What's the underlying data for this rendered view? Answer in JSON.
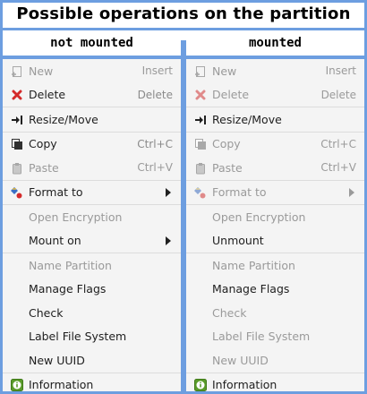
{
  "title": "Possible operations on the partition",
  "columns": {
    "left": {
      "heading": "not mounted"
    },
    "right": {
      "heading": "mounted"
    }
  },
  "colors": {
    "accent": "#6d9ee0",
    "disabled_text": "#9a9a9a",
    "delete_red": "#d42a2a",
    "info_green": "#5a9b2a"
  },
  "left_menu": {
    "new": {
      "label": "New",
      "shortcut": "Insert",
      "enabled": false,
      "icon": "new-document-icon"
    },
    "delete": {
      "label": "Delete",
      "shortcut": "Delete",
      "enabled": true,
      "icon": "delete-x-icon"
    },
    "resize": {
      "label": "Resize/Move",
      "enabled": true,
      "icon": "resize-arrow-icon"
    },
    "copy": {
      "label": "Copy",
      "shortcut": "Ctrl+C",
      "enabled": true,
      "icon": "copy-icon"
    },
    "paste": {
      "label": "Paste",
      "shortcut": "Ctrl+V",
      "enabled": false,
      "icon": "paste-icon"
    },
    "format": {
      "label": "Format to",
      "enabled": true,
      "icon": "format-icon",
      "has_submenu": true
    },
    "open_encryption": {
      "label": "Open Encryption",
      "enabled": false
    },
    "mount": {
      "label": "Mount on",
      "enabled": true,
      "has_submenu": true
    },
    "name_partition": {
      "label": "Name Partition",
      "enabled": false
    },
    "manage_flags": {
      "label": "Manage Flags",
      "enabled": true
    },
    "check": {
      "label": "Check",
      "enabled": true
    },
    "label_fs": {
      "label": "Label File System",
      "enabled": true
    },
    "new_uuid": {
      "label": "New UUID",
      "enabled": true
    },
    "information": {
      "label": "Information",
      "enabled": true,
      "icon": "info-icon"
    }
  },
  "right_menu": {
    "new": {
      "label": "New",
      "shortcut": "Insert",
      "enabled": false,
      "icon": "new-document-icon"
    },
    "delete": {
      "label": "Delete",
      "shortcut": "Delete",
      "enabled": false,
      "icon": "delete-x-icon"
    },
    "resize": {
      "label": "Resize/Move",
      "enabled": true,
      "icon": "resize-arrow-icon"
    },
    "copy": {
      "label": "Copy",
      "shortcut": "Ctrl+C",
      "enabled": false,
      "icon": "copy-icon"
    },
    "paste": {
      "label": "Paste",
      "shortcut": "Ctrl+V",
      "enabled": false,
      "icon": "paste-icon"
    },
    "format": {
      "label": "Format to",
      "enabled": false,
      "icon": "format-icon",
      "has_submenu": true
    },
    "open_encryption": {
      "label": "Open Encryption",
      "enabled": false
    },
    "unmount": {
      "label": "Unmount",
      "enabled": true
    },
    "name_partition": {
      "label": "Name Partition",
      "enabled": false
    },
    "manage_flags": {
      "label": "Manage Flags",
      "enabled": true
    },
    "check": {
      "label": "Check",
      "enabled": false
    },
    "label_fs": {
      "label": "Label File System",
      "enabled": false
    },
    "new_uuid": {
      "label": "New UUID",
      "enabled": false
    },
    "information": {
      "label": "Information",
      "enabled": true,
      "icon": "info-icon"
    }
  }
}
